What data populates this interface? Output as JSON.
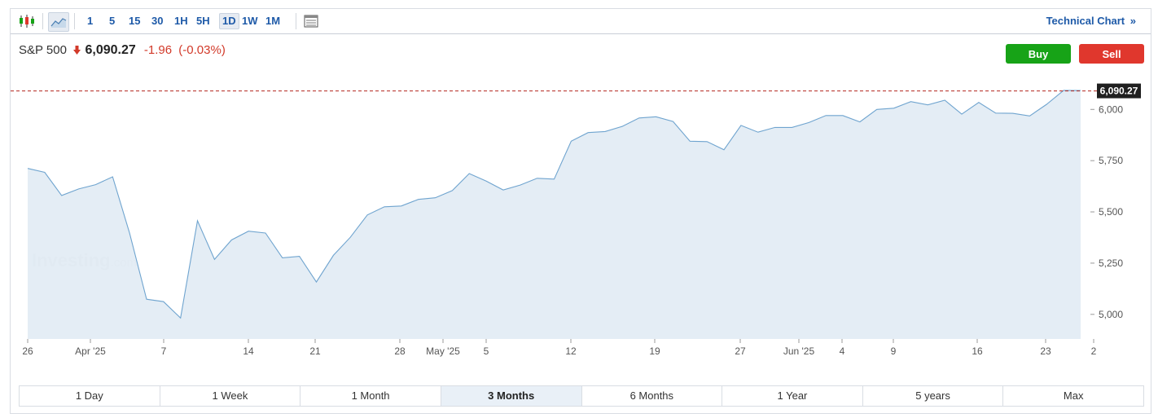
{
  "toolbar": {
    "icons": [
      "candlestick-chart-icon",
      "area-chart-icon",
      "table-view-icon"
    ],
    "intervals": [
      "1",
      "5",
      "15",
      "30",
      "1H",
      "5H",
      "1D",
      "1W",
      "1M"
    ],
    "active_interval": "1D",
    "technical_chart_label": "Technical Chart",
    "technical_chart_glyph": "»"
  },
  "quote": {
    "name": "S&P 500",
    "direction": "down",
    "price": "6,090.27",
    "change": "-1.96",
    "change_pct": "(-0.03%)"
  },
  "buttons": {
    "buy": "Buy",
    "sell": "Sell"
  },
  "colors": {
    "buy": "#17a317",
    "sell": "#e0372d",
    "line": "#6fa4cf",
    "fill": "#e3ecf4",
    "down": "#d23a2a",
    "price_tag": "#1f1f1f"
  },
  "watermark": {
    "brand": "Investing",
    "suffix": ".com"
  },
  "chart_data": {
    "type": "area",
    "title": "",
    "xlabel": "",
    "ylabel": "",
    "ylim": [
      4880,
      6180
    ],
    "y_ticks": [
      5000,
      5250,
      5500,
      5750,
      6000
    ],
    "y_tick_labels": [
      "5,000",
      "5,250",
      "5,500",
      "5,750",
      "6,000"
    ],
    "x_ticks": [
      "26",
      "Apr '25",
      "7",
      "14",
      "21",
      "28",
      "May '25",
      "5",
      "12",
      "19",
      "27",
      "Jun '25",
      "4",
      "9",
      "16",
      "23",
      "2"
    ],
    "last_price_label": "6,090.27",
    "last_price": 6090.27,
    "x": [
      "2025-03-26",
      "2025-03-27",
      "2025-03-28",
      "2025-03-31",
      "2025-04-01",
      "2025-04-02",
      "2025-04-03",
      "2025-04-04",
      "2025-04-07",
      "2025-04-08",
      "2025-04-09",
      "2025-04-10",
      "2025-04-11",
      "2025-04-14",
      "2025-04-15",
      "2025-04-16",
      "2025-04-17",
      "2025-04-21",
      "2025-04-22",
      "2025-04-23",
      "2025-04-24",
      "2025-04-25",
      "2025-04-28",
      "2025-04-29",
      "2025-04-30",
      "2025-05-01",
      "2025-05-02",
      "2025-05-05",
      "2025-05-06",
      "2025-05-07",
      "2025-05-08",
      "2025-05-09",
      "2025-05-12",
      "2025-05-13",
      "2025-05-14",
      "2025-05-15",
      "2025-05-16",
      "2025-05-19",
      "2025-05-20",
      "2025-05-21",
      "2025-05-22",
      "2025-05-23",
      "2025-05-27",
      "2025-05-28",
      "2025-05-29",
      "2025-05-30",
      "2025-06-02",
      "2025-06-03",
      "2025-06-04",
      "2025-06-05",
      "2025-06-06",
      "2025-06-09",
      "2025-06-10",
      "2025-06-11",
      "2025-06-12",
      "2025-06-13",
      "2025-06-16",
      "2025-06-17",
      "2025-06-18",
      "2025-06-20",
      "2025-06-23",
      "2025-06-24",
      "2025-06-25"
    ],
    "values": [
      5712,
      5693,
      5580,
      5612,
      5633,
      5671,
      5397,
      5074,
      5062,
      4982,
      5457,
      5268,
      5363,
      5406,
      5397,
      5276,
      5283,
      5158,
      5288,
      5376,
      5485,
      5525,
      5529,
      5561,
      5569,
      5604,
      5687,
      5650,
      5607,
      5631,
      5664,
      5660,
      5845,
      5887,
      5892,
      5917,
      5958,
      5964,
      5941,
      5845,
      5843,
      5803,
      5922,
      5889,
      5912,
      5912,
      5936,
      5970,
      5970,
      5939,
      6000,
      6006,
      6038,
      6022,
      6045,
      5977,
      6034,
      5982,
      5981,
      5968,
      6025,
      6093,
      6092
    ]
  },
  "ranges": [
    "1 Day",
    "1 Week",
    "1 Month",
    "3 Months",
    "6 Months",
    "1 Year",
    "5 years",
    "Max"
  ],
  "active_range": "3 Months"
}
